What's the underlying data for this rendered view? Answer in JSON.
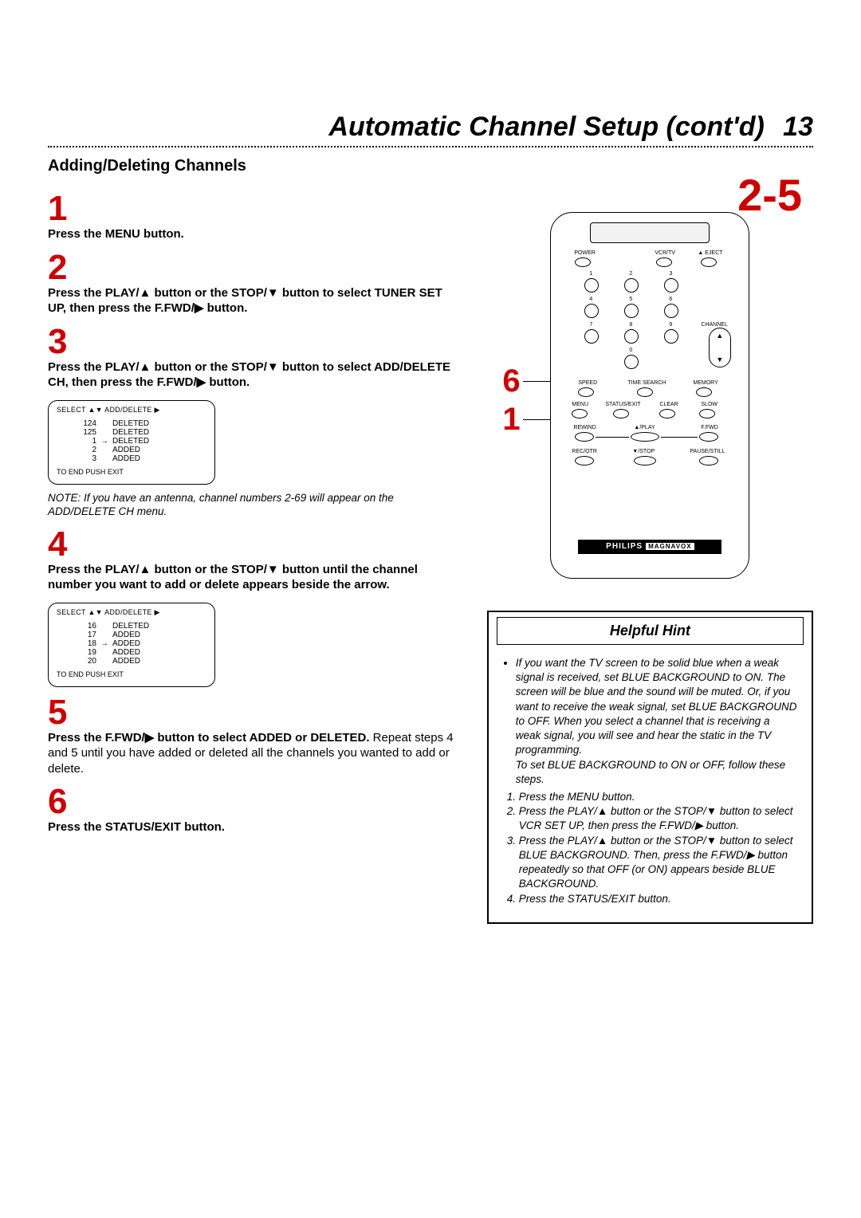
{
  "header": {
    "page_title": "Automatic Channel Setup (cont'd)",
    "page_number": "13"
  },
  "section_title": "Adding/Deleting Channels",
  "right_big_label": "2-5",
  "steps": {
    "s1": {
      "num": "1",
      "bold": "Press the MENU button.",
      "rest": ""
    },
    "s2": {
      "num": "2",
      "bold": "Press the PLAY/▲ button or the STOP/▼ button to select TUNER SET UP, then press the F.FWD/▶ button.",
      "rest": ""
    },
    "s3": {
      "num": "3",
      "bold": "Press the PLAY/▲ button or the STOP/▼ button to select ADD/DELETE CH, then press the F.FWD/▶ button.",
      "rest": ""
    },
    "s3_note": "NOTE: If you have an antenna, channel numbers 2-69 will appear on the ADD/DELETE CH menu.",
    "s4": {
      "num": "4",
      "bold": "Press the PLAY/▲ button or the STOP/▼ button until the channel number you want to add or delete appears beside the arrow.",
      "rest": ""
    },
    "s5": {
      "num": "5",
      "bold": "Press the F.FWD/▶ button to select ADDED or DELETED.",
      "rest": " Repeat steps 4 and 5 until you have added or deleted all the channels you wanted to add or delete."
    },
    "s6": {
      "num": "6",
      "bold": "Press the STATUS/EXIT button.",
      "rest": ""
    }
  },
  "osd1": {
    "header": "SELECT ▲▼ ADD/DELETE ▶",
    "rows": [
      {
        "ch": "124",
        "arrow": "",
        "status": "DELETED"
      },
      {
        "ch": "125",
        "arrow": "",
        "status": "DELETED"
      },
      {
        "ch": "1",
        "arrow": "→",
        "status": "DELETED"
      },
      {
        "ch": "2",
        "arrow": "",
        "status": "ADDED"
      },
      {
        "ch": "3",
        "arrow": "",
        "status": "ADDED"
      }
    ],
    "footer": "TO END PUSH EXIT"
  },
  "osd2": {
    "header": "SELECT ▲▼ ADD/DELETE ▶",
    "rows": [
      {
        "ch": "16",
        "arrow": "",
        "status": "DELETED"
      },
      {
        "ch": "17",
        "arrow": "",
        "status": "ADDED"
      },
      {
        "ch": "18",
        "arrow": "→",
        "status": "ADDED"
      },
      {
        "ch": "19",
        "arrow": "",
        "status": "ADDED"
      },
      {
        "ch": "20",
        "arrow": "",
        "status": "ADDED"
      }
    ],
    "footer": "TO END PUSH EXIT"
  },
  "remote": {
    "callout_6": "6",
    "callout_1": "1",
    "labels": {
      "power": "POWER",
      "vcrtv": "VCR/TV",
      "eject": "▲ EJECT",
      "n1": "1",
      "n2": "2",
      "n3": "3",
      "n4": "4",
      "n5": "5",
      "n6": "6",
      "n7": "7",
      "n8": "8",
      "n9": "9",
      "n0": "0",
      "channel": "CHANNEL",
      "speed": "SPEED",
      "timesearch": "TIME SEARCH",
      "memory": "MEMORY",
      "menu": "MENU",
      "statusexit": "STATUS/EXIT",
      "clear": "CLEAR",
      "slow": "SLOW",
      "rewind": "REWIND",
      "play": "▲/PLAY",
      "ffwd": "F.FWD",
      "recotr": "REC/OTR",
      "stop": "▼/STOP",
      "pausestill": "PAUSE/STILL"
    },
    "brand1": "PHILIPS",
    "brand2": "MAGNAVOX"
  },
  "hint": {
    "title": "Helpful Hint",
    "bullet": "If you want the TV screen to be solid blue when a weak signal is received, set BLUE BACKGROUND to ON. The screen will be blue and the sound will be muted. Or, if you want to receive the weak signal, set BLUE BACKGROUND to OFF. When you select a channel that is receiving a weak signal, you will see and hear the static in the TV programming.",
    "sub": "To set BLUE BACKGROUND to ON or OFF, follow these steps.",
    "steps": [
      "Press the MENU button.",
      "Press the PLAY/▲ button or the STOP/▼ button to select VCR SET UP, then press the F.FWD/▶ button.",
      "Press the PLAY/▲ button or the STOP/▼ button to select BLUE BACKGROUND. Then, press the F.FWD/▶ button repeatedly so that OFF (or ON) appears beside BLUE BACKGROUND.",
      "Press the STATUS/EXIT button."
    ]
  }
}
